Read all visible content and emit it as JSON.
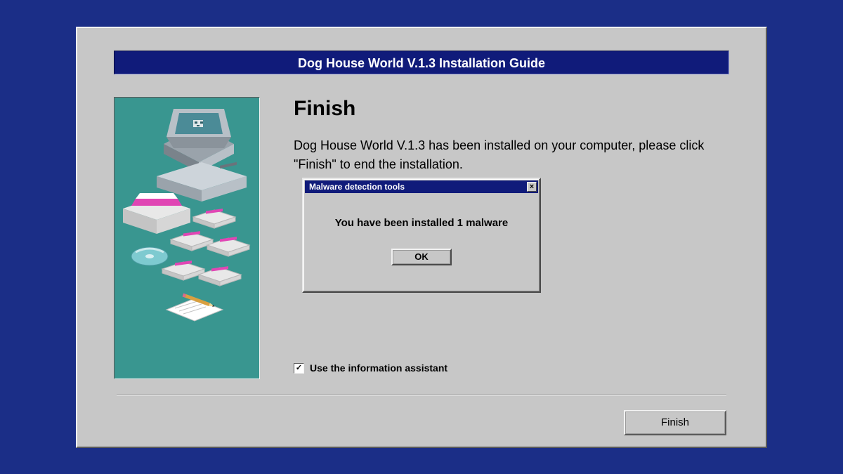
{
  "installer": {
    "title": "Dog House World V.1.3 Installation Guide",
    "heading": "Finish",
    "description": "Dog House World V.1.3 has been installed on your computer, please click \"Finish\" to end the installation.",
    "checkbox_label": "Use the information assistant",
    "checkbox_checked": true,
    "finish_button": "Finish"
  },
  "popup": {
    "title": "Malware detection tools",
    "message": "You have been installed 1 malware",
    "ok_button": "OK",
    "close_glyph": "×"
  },
  "checkbox_glyph": "✓"
}
